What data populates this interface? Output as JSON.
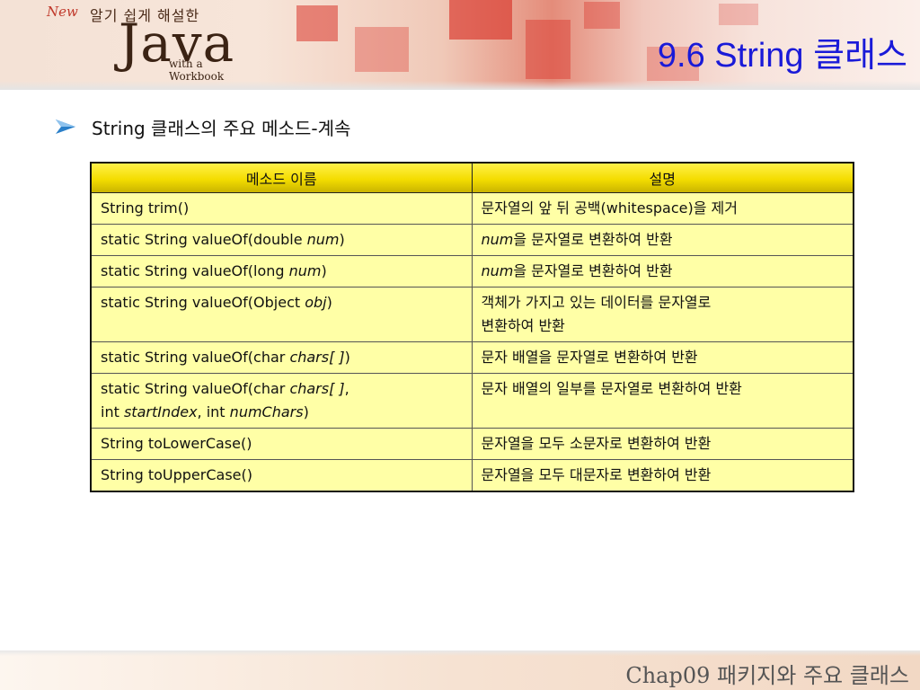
{
  "header": {
    "logo": {
      "new": "New",
      "tagline": "알기 쉽게 해설한",
      "word": "Java",
      "sub": "with a Workbook"
    },
    "title": "9.6 String 클래스"
  },
  "bullet": {
    "text": "String 클래스의 주요 메소드-계속"
  },
  "table": {
    "headers": [
      "메소드 이름",
      "설명"
    ],
    "rows": [
      {
        "method": [
          [
            [
              "String trim()",
              false
            ]
          ]
        ],
        "desc": [
          [
            "문자열의 앞 뒤 공백(whitespace)을 제거",
            false
          ]
        ]
      },
      {
        "method": [
          [
            [
              "static String valueOf(double ",
              false
            ],
            [
              "num",
              true
            ],
            [
              ")",
              false
            ]
          ]
        ],
        "desc": [
          [
            "num",
            true
          ],
          [
            "을 문자열로 변환하여 반환",
            false
          ]
        ]
      },
      {
        "method": [
          [
            [
              "static String valueOf(long ",
              false
            ],
            [
              "num",
              true
            ],
            [
              ")",
              false
            ]
          ]
        ],
        "desc": [
          [
            "num",
            true
          ],
          [
            "을 문자열로 변환하여 반환",
            false
          ]
        ]
      },
      {
        "method": [
          [
            [
              "static String valueOf(Object ",
              false
            ],
            [
              "obj",
              true
            ],
            [
              ")",
              false
            ]
          ]
        ],
        "desc": [
          [
            "객체가 가지고 있는 데이터를 문자열로",
            false
          ],
          [
            "\n",
            false
          ],
          [
            "변환하여 반환",
            false
          ]
        ]
      },
      {
        "method": [
          [
            [
              "static String valueOf(char ",
              false
            ],
            [
              "chars[ ]",
              true
            ],
            [
              ")",
              false
            ]
          ]
        ],
        "desc": [
          [
            "문자 배열을 문자열로 변환하여 반환",
            false
          ]
        ]
      },
      {
        "method": [
          [
            [
              "static String valueOf(char ",
              false
            ],
            [
              "chars[ ]",
              true
            ],
            [
              ",",
              false
            ]
          ],
          [
            [
              "int ",
              false
            ],
            [
              "startIndex",
              true
            ],
            [
              ", int ",
              false
            ],
            [
              "numChars",
              true
            ],
            [
              ")",
              false
            ]
          ]
        ],
        "desc": [
          [
            "문자 배열의 일부를 문자열로 변환하여 반환",
            false
          ]
        ]
      },
      {
        "method": [
          [
            [
              "String toLowerCase()",
              false
            ]
          ]
        ],
        "desc": [
          [
            "문자열을 모두 소문자로 변환하여 반환",
            false
          ]
        ]
      },
      {
        "method": [
          [
            [
              "String toUpperCase()",
              false
            ]
          ]
        ],
        "desc": [
          [
            "문자열을 모두 대문자로 변환하여 반환",
            false
          ]
        ]
      }
    ]
  },
  "footer": {
    "text": "Chap09 패키지와 주요 클래스"
  },
  "colors": {
    "title": "#1a1ad8",
    "header_cell": "#f4dd00",
    "body_cell": "#ffffa6",
    "bullet": "#2a7fc9"
  },
  "icons": {
    "bullet": "arrow-bullet-icon"
  }
}
